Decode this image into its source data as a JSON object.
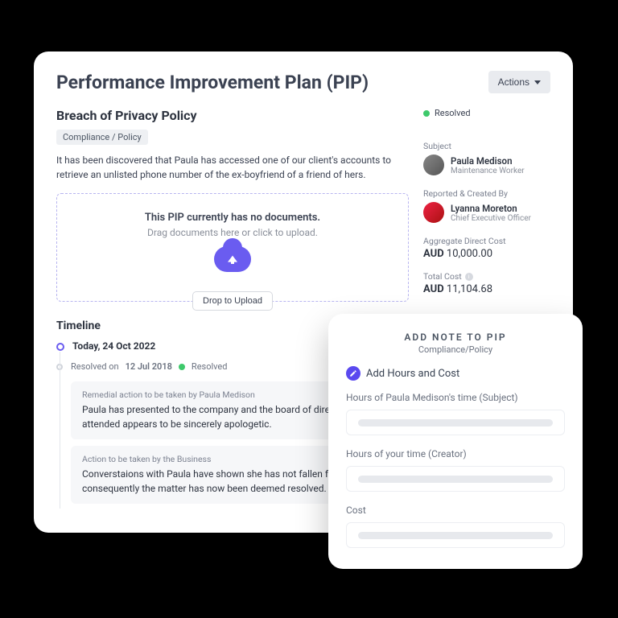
{
  "header": {
    "title": "Performance Improvement Plan (PIP)",
    "actions_label": "Actions"
  },
  "pip": {
    "title": "Breach of Privacy Policy",
    "category": "Compliance / Policy",
    "description": "It has been discovered that Paula has accessed one of our client's accounts to retrieve an unlisted phone number of the ex-boyfriend of a friend of hers.",
    "status": "Resolved"
  },
  "upload": {
    "title": "This PIP currently has no documents.",
    "subtitle": "Drag documents here or click to upload.",
    "button": "Drop to Upload"
  },
  "timeline": {
    "heading": "Timeline",
    "today": "Today, 24 Oct 2022",
    "resolved_prefix": "Resolved on",
    "resolved_date": "12 Jul 2018",
    "resolved_label": "Resolved",
    "entries": [
      {
        "label": "Remedial action to be taken by Paula Medison",
        "text": "Paula has presented to the company and the board of directors and attended appears to be sincerely apologetic."
      },
      {
        "label": "Action to be taken by the Business",
        "text": "Converstaions with Paula have shown she has not fallen foul of any consequently the matter has now been deemed resolved."
      }
    ]
  },
  "sidebar": {
    "subject_label": "Subject",
    "subject_name": "Paula Medison",
    "subject_role": "Maintenance Worker",
    "reporter_label": "Reported & Created By",
    "reporter_name": "Lyanna Moreton",
    "reporter_role": "Chief Executive Officer",
    "agg_label": "Aggregate Direct Cost",
    "agg_currency": "AUD",
    "agg_value": "10,000.00",
    "total_label": "Total Cost",
    "total_currency": "AUD",
    "total_value": "11,104.68"
  },
  "modal": {
    "title": "ADD NOTE TO PIP",
    "subtitle": "Compliance/Policy",
    "section": "Add Hours and Cost",
    "field1": "Hours of Paula Medison's time (Subject)",
    "field2": "Hours of your time (Creator)",
    "field3": "Cost"
  }
}
